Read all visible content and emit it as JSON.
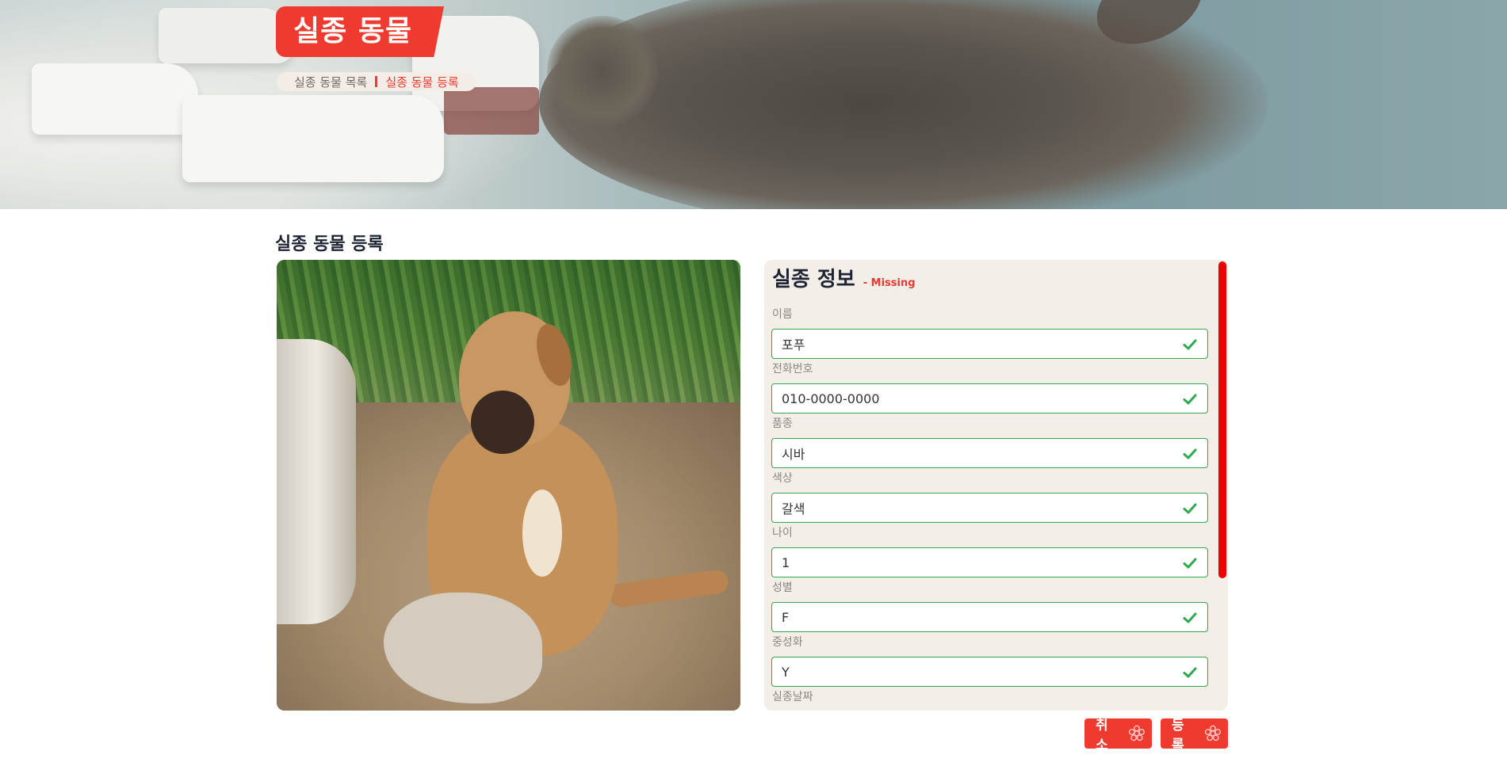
{
  "hero": {
    "title": "실종 동물",
    "breadcrumb": {
      "link": "실종 동물 목록",
      "current": "실종 동물 등록"
    }
  },
  "page": {
    "title": "실종 동물 등록"
  },
  "panel": {
    "title": "실종 정보",
    "subtitle": "- Missing",
    "fields": [
      {
        "label": "이름",
        "value": "포푸"
      },
      {
        "label": "전화번호",
        "value": "010-0000-0000"
      },
      {
        "label": "품종",
        "value": "시바"
      },
      {
        "label": "색상",
        "value": "갈색"
      },
      {
        "label": "나이",
        "value": "1"
      },
      {
        "label": "성별",
        "value": "F"
      },
      {
        "label": "중성화",
        "value": "Y"
      },
      {
        "label": "실종날짜",
        "value": ""
      }
    ]
  },
  "actions": {
    "cancel_label": "취소",
    "submit_label": "등록"
  },
  "colors": {
    "accent": "#ef3a2f",
    "valid": "#2fa84f",
    "panel_bg": "#f3eee8"
  },
  "icons": {
    "valid": "check-icon",
    "button": "paw-flower-icon"
  }
}
